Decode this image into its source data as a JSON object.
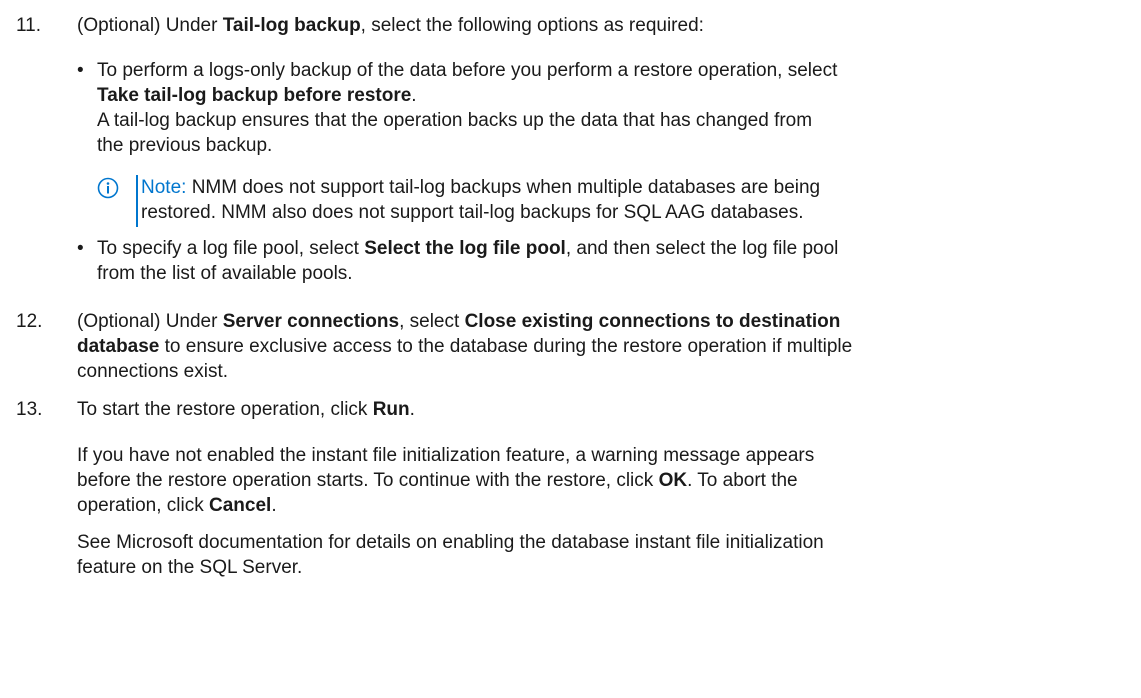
{
  "step11": {
    "number": "11.",
    "prefix": "(Optional) Under ",
    "bold": "Tail-log backup",
    "suffix": ", select the following options as required:"
  },
  "bullet1": {
    "dot": "•",
    "line1": "To perform a logs-only backup of the data before you perform a restore operation, select",
    "bold": "Take tail-log backup before restore",
    "bold_suffix": ".",
    "line3": "A tail-log backup ensures that the operation backs up the data that has changed from",
    "line4": "the previous backup."
  },
  "note": {
    "icon": "info-circle-icon",
    "label": "Note:",
    "line1": " NMM does not support tail-log backups when multiple databases are being",
    "line2": "restored. NMM also does not support tail-log backups for SQL AAG databases."
  },
  "bullet2": {
    "dot": "•",
    "prefix": "To specify a log file pool, select ",
    "bold": "Select the log file pool",
    "suffix": ", and then select the log file pool",
    "line2": "from the list of available pools."
  },
  "step12": {
    "number": "12.",
    "prefix": "(Optional) Under ",
    "bold1": "Server connections",
    "mid": ", select ",
    "bold2": "Close existing connections to destination",
    "bold3": "database",
    "line2_suffix": " to ensure exclusive access to the database during the restore operation if multiple",
    "line3": "connections exist."
  },
  "step13": {
    "number": "13.",
    "prefix": "To start the restore operation, click ",
    "bold": "Run",
    "suffix": "."
  },
  "para1": {
    "line1": "If you have not enabled the instant file initialization feature, a warning message appears",
    "line2_prefix": "before the restore operation starts. To continue with the restore, click ",
    "line2_bold": "OK",
    "line2_suffix": ". To abort the",
    "line3_prefix": "operation, click ",
    "line3_bold": "Cancel",
    "line3_suffix": "."
  },
  "para2": {
    "line1": "See Microsoft documentation for details on enabling the database instant file initialization",
    "line2": "feature on the SQL Server."
  },
  "colors": {
    "text": "#1a1a1a",
    "accent": "#0076ce"
  }
}
